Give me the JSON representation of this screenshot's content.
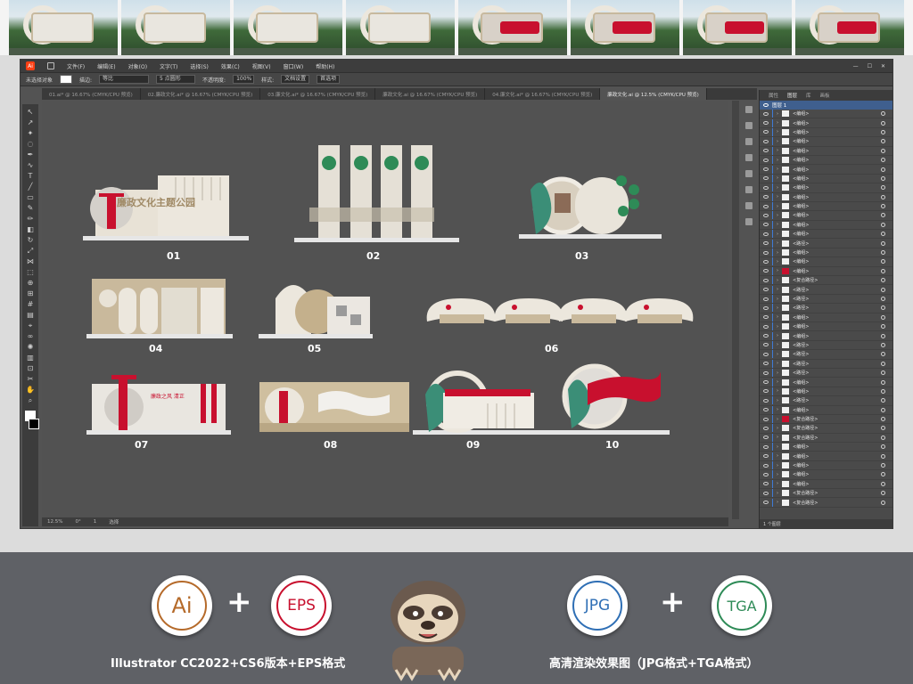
{
  "thumbnails": [
    {
      "style": "plain"
    },
    {
      "style": "plain"
    },
    {
      "style": "plain"
    },
    {
      "style": "plain"
    },
    {
      "style": "red"
    },
    {
      "style": "red"
    },
    {
      "style": "red"
    },
    {
      "style": "red"
    }
  ],
  "menubar": {
    "items": [
      "文件(F)",
      "编辑(E)",
      "对象(O)",
      "文字(T)",
      "选择(S)",
      "效果(C)",
      "视图(V)",
      "窗口(W)",
      "帮助(H)"
    ]
  },
  "controlbar": {
    "selection_label": "未选择对象",
    "stroke_label": "描边:",
    "stroke_style": "等比",
    "brush_label": "5 点圆形",
    "opacity_label": "不透明度:",
    "opacity_value": "100%",
    "style_label": "样式:",
    "doc_setup_button": "文档设置",
    "prefs_button": "首选项"
  },
  "tabs": [
    {
      "label": "01.ai* @ 16.67% (CMYK/CPU 预览)",
      "active": false
    },
    {
      "label": "02.廉政文化.ai* @ 16.67% (CMYK/CPU 预览)",
      "active": false
    },
    {
      "label": "03.廉文化.ai* @ 16.67% (CMYK/CPU 预览)",
      "active": false
    },
    {
      "label": "廉政文化.ai @ 16.67% (CMYK/CPU 预览)",
      "active": false
    },
    {
      "label": "04.廉文化.ai* @ 16.67% (CMYK/CPU 预览)",
      "active": false
    },
    {
      "label": "廉政文化.ai @ 12.5% (CMYK/CPU 预览)",
      "active": true
    }
  ],
  "artboards": [
    {
      "label": "01",
      "title": "廉政文化主题公园"
    },
    {
      "label": "02"
    },
    {
      "label": "03"
    },
    {
      "label": "04"
    },
    {
      "label": "05"
    },
    {
      "label": "06"
    },
    {
      "label": "07"
    },
    {
      "label": "08"
    },
    {
      "label": "09"
    },
    {
      "label": "10"
    }
  ],
  "status": {
    "zoom": "12.5%",
    "angle": "0°",
    "artboard": "1",
    "tool": "选择"
  },
  "layers_panel": {
    "tabs": [
      "属性",
      "图层",
      "库",
      "画板"
    ],
    "active_tab": "图层",
    "top_layer": "图层 1",
    "rows": [
      "<编组>",
      "<编组>",
      "<编组>",
      "<编组>",
      "<编组>",
      "<编组>",
      "<编组>",
      "<编组>",
      "<编组>",
      "<编组>",
      "<编组>",
      "<编组>",
      "<编组>",
      "<编组>",
      "<路径>",
      "<编组>",
      "<编组>",
      "<编组>",
      "<复合路径>",
      "<路径>",
      "<路径>",
      "<路径>",
      "<编组>",
      "<编组>",
      "<编组>",
      "<路径>",
      "<路径>",
      "<路径>",
      "<路径>",
      "<编组>",
      "<编组>",
      "<路径>",
      "<编组>",
      "<复合路径>",
      "<复合路径>",
      "<复合路径>",
      "<编组>",
      "<编组>",
      "<编组>",
      "<编组>",
      "<编组>",
      "<复合路径>",
      "<复合路径>"
    ],
    "red_rows": [
      17,
      33
    ],
    "footer": "1 个图层"
  },
  "promo": {
    "badges": [
      {
        "label": "Ai",
        "color": "#b56a2a"
      },
      {
        "label": "EPS",
        "color": "#c8102e"
      },
      {
        "label": "JPG",
        "color": "#2f6fb5"
      },
      {
        "label": "TGA",
        "color": "#2e8b57"
      }
    ],
    "plus": "+",
    "left_caption": "Illustrator CC2022+CS6版本+EPS格式",
    "right_caption": "高清渲染效果图（JPG格式+TGA格式）"
  }
}
